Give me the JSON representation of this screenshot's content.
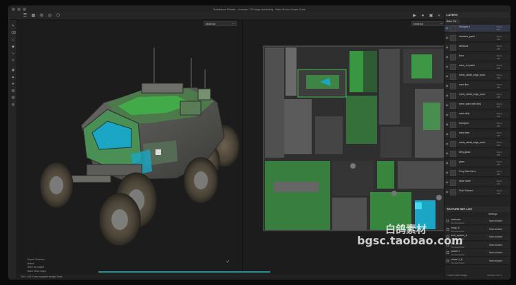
{
  "title": "Substance Painter - License: 170 days remaining - Mars Rover Green Color",
  "viewport_left": {
    "mode": "Material"
  },
  "viewport_right": {
    "mode": "Material"
  },
  "layers_panel": {
    "title": "LAYERS",
    "channel": "Base Col",
    "layers": [
      {
        "name": "Fill layer 4",
        "blend": "Norm",
        "opacity": "100"
      },
      {
        "name": "machine_paint",
        "blend": "Norm",
        "opacity": "100"
      },
      {
        "name": "windows",
        "blend": "Norm",
        "opacity": "100"
      },
      {
        "name": "lines",
        "blend": "Norm",
        "opacity": "100"
      },
      {
        "name": "ment_cut parts",
        "blend": "Norm",
        "opacity": "100"
      },
      {
        "name": "merls_detail_edge_wear",
        "blend": "Norm",
        "opacity": "100"
      },
      {
        "name": "ment line",
        "blend": "Norm",
        "opacity": "100"
      },
      {
        "name": "merls_detail_edge_wear",
        "blend": "Norm",
        "opacity": "100"
      },
      {
        "name": "ment_paint with dirty",
        "blend": "Norm",
        "opacity": "100"
      },
      {
        "name": "ment dirty",
        "blend": "Norm",
        "opacity": "100"
      },
      {
        "name": "handgrim",
        "blend": "Norm",
        "opacity": "100"
      },
      {
        "name": "ment tires",
        "blend": "Norm",
        "opacity": "100"
      },
      {
        "name": "merls_detail_edge_wear",
        "blend": "Norm",
        "opacity": "100"
      },
      {
        "name": "Dirty glass",
        "blend": "Norm",
        "opacity": "100"
      },
      {
        "name": "glass",
        "blend": "Norm",
        "opacity": "100"
      },
      {
        "name": "Grey Steel farm",
        "blend": "Norm",
        "opacity": "100"
      },
      {
        "name": "white Steel",
        "blend": "Norm",
        "opacity": "100"
      },
      {
        "name": "Fluid Stained",
        "blend": "Norm",
        "opacity": "100"
      }
    ]
  },
  "texture_set_list": {
    "title": "TEXTURE SET LIST",
    "settings": "Settings",
    "items": [
      {
        "name": "windows",
        "desc": "No description",
        "shader": "Main shader"
      },
      {
        "name": "body_A",
        "desc": "No description",
        "shader": "Main shader"
      },
      {
        "name": "bed_system_A",
        "desc": "No description",
        "shader": "Main shader"
      },
      {
        "name": "tire_body",
        "desc": "No description",
        "shader": "Main shader"
      },
      {
        "name": "wheel 1",
        "desc": "No description",
        "shader": "Main shader"
      },
      {
        "name": "wheel 1_B",
        "desc": "No description",
        "shader": "Main shader"
      }
    ]
  },
  "log": [
    "Export Textures...",
    "Bakes",
    "Save as project",
    "Bake Mesh Maps"
  ],
  "status": "Ctrl + Left: Draw snapped straight lines",
  "status_right": "Cache Disk Usage:",
  "version": "Version: 8.2.1",
  "watermark": {
    "logo": "白鸽素材",
    "url": "bgsc.taobao.com",
    "small": "白鸽素材 bgsc.taobao.com"
  },
  "colors": {
    "accent": "#2a8f9c",
    "green": "#3fbf4a",
    "glass": "#1aa6c4"
  }
}
